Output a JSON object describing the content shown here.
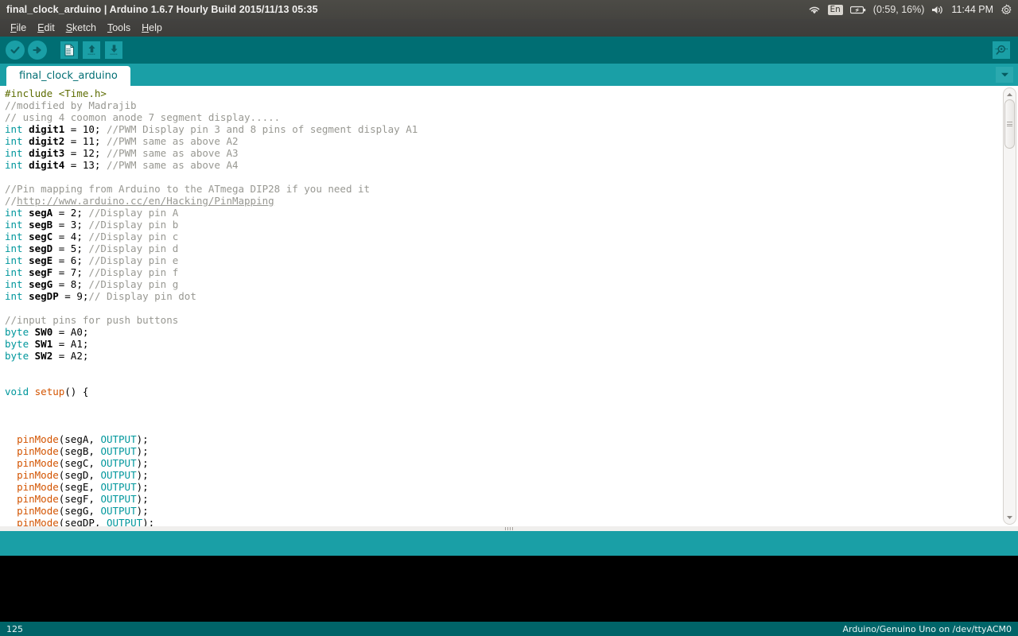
{
  "window": {
    "title": "final_clock_arduino | Arduino 1.6.7 Hourly Build 2015/11/13 05:35"
  },
  "tray": {
    "wifi_icon": "wifi-icon",
    "keyboard_layout": "En",
    "battery_icon": "battery-charging-icon",
    "battery_status": "(0:59, 16%)",
    "volume_icon": "volume-icon",
    "clock": "11:44 PM",
    "settings_icon": "gear-icon"
  },
  "menubar": {
    "items": [
      {
        "mnemonic": "F",
        "rest": "ile"
      },
      {
        "mnemonic": "E",
        "rest": "dit"
      },
      {
        "mnemonic": "S",
        "rest": "ketch"
      },
      {
        "mnemonic": "T",
        "rest": "ools"
      },
      {
        "mnemonic": "H",
        "rest": "elp"
      }
    ]
  },
  "toolbar": {
    "verify": "Verify",
    "upload": "Upload",
    "new": "New",
    "open": "Open",
    "save": "Save",
    "serial_monitor": "Serial Monitor"
  },
  "tabs": {
    "active_label": "final_clock_arduino",
    "menu_icon": "chevron-down-icon"
  },
  "editor": {
    "lines": [
      [
        {
          "t": "#include ",
          "c": "pp"
        },
        {
          "t": "<Time.h>",
          "c": "pp"
        }
      ],
      [
        {
          "t": "//modified by Madrajib",
          "c": "c"
        }
      ],
      [
        {
          "t": "// using 4 coomon anode 7 segment display.....",
          "c": "c"
        }
      ],
      [
        {
          "t": "int",
          "c": "k"
        },
        {
          "t": " ",
          "c": ""
        },
        {
          "t": "digit1",
          "c": "b"
        },
        {
          "t": " = 10; ",
          "c": ""
        },
        {
          "t": "//PWM Display pin 3 and 8 pins of segment display A1",
          "c": "c"
        }
      ],
      [
        {
          "t": "int",
          "c": "k"
        },
        {
          "t": " ",
          "c": ""
        },
        {
          "t": "digit2",
          "c": "b"
        },
        {
          "t": " = 11; ",
          "c": ""
        },
        {
          "t": "//PWM same as above A2",
          "c": "c"
        }
      ],
      [
        {
          "t": "int",
          "c": "k"
        },
        {
          "t": " ",
          "c": ""
        },
        {
          "t": "digit3",
          "c": "b"
        },
        {
          "t": " = 12; ",
          "c": ""
        },
        {
          "t": "//PWM same as above A3",
          "c": "c"
        }
      ],
      [
        {
          "t": "int",
          "c": "k"
        },
        {
          "t": " ",
          "c": ""
        },
        {
          "t": "digit4",
          "c": "b"
        },
        {
          "t": " = 13; ",
          "c": ""
        },
        {
          "t": "//PWM same as above A4",
          "c": "c"
        }
      ],
      [
        {
          "t": "",
          "c": ""
        }
      ],
      [
        {
          "t": "//Pin mapping from Arduino to the ATmega DIP28 if you need it",
          "c": "c"
        }
      ],
      [
        {
          "t": "//",
          "c": "c"
        },
        {
          "t": "http://www.arduino.cc/en/Hacking/PinMapping",
          "c": "lnk"
        }
      ],
      [
        {
          "t": "int",
          "c": "k"
        },
        {
          "t": " ",
          "c": ""
        },
        {
          "t": "segA",
          "c": "b"
        },
        {
          "t": " = 2; ",
          "c": ""
        },
        {
          "t": "//Display pin A",
          "c": "c"
        }
      ],
      [
        {
          "t": "int",
          "c": "k"
        },
        {
          "t": " ",
          "c": ""
        },
        {
          "t": "segB",
          "c": "b"
        },
        {
          "t": " = 3; ",
          "c": ""
        },
        {
          "t": "//Display pin b",
          "c": "c"
        }
      ],
      [
        {
          "t": "int",
          "c": "k"
        },
        {
          "t": " ",
          "c": ""
        },
        {
          "t": "segC",
          "c": "b"
        },
        {
          "t": " = 4; ",
          "c": ""
        },
        {
          "t": "//Display pin c",
          "c": "c"
        }
      ],
      [
        {
          "t": "int",
          "c": "k"
        },
        {
          "t": " ",
          "c": ""
        },
        {
          "t": "segD",
          "c": "b"
        },
        {
          "t": " = 5; ",
          "c": ""
        },
        {
          "t": "//Display pin d",
          "c": "c"
        }
      ],
      [
        {
          "t": "int",
          "c": "k"
        },
        {
          "t": " ",
          "c": ""
        },
        {
          "t": "segE",
          "c": "b"
        },
        {
          "t": " = 6; ",
          "c": ""
        },
        {
          "t": "//Display pin e",
          "c": "c"
        }
      ],
      [
        {
          "t": "int",
          "c": "k"
        },
        {
          "t": " ",
          "c": ""
        },
        {
          "t": "segF",
          "c": "b"
        },
        {
          "t": " = 7; ",
          "c": ""
        },
        {
          "t": "//Display pin f",
          "c": "c"
        }
      ],
      [
        {
          "t": "int",
          "c": "k"
        },
        {
          "t": " ",
          "c": ""
        },
        {
          "t": "segG",
          "c": "b"
        },
        {
          "t": " = 8; ",
          "c": ""
        },
        {
          "t": "//Display pin g",
          "c": "c"
        }
      ],
      [
        {
          "t": "int",
          "c": "k"
        },
        {
          "t": " ",
          "c": ""
        },
        {
          "t": "segDP",
          "c": "b"
        },
        {
          "t": " = 9;",
          "c": ""
        },
        {
          "t": "// Display pin dot",
          "c": "c"
        }
      ],
      [
        {
          "t": "",
          "c": ""
        }
      ],
      [
        {
          "t": "//input pins for push buttons",
          "c": "c"
        }
      ],
      [
        {
          "t": "byte",
          "c": "k"
        },
        {
          "t": " ",
          "c": ""
        },
        {
          "t": "SW0",
          "c": "b"
        },
        {
          "t": " = A0;",
          "c": ""
        }
      ],
      [
        {
          "t": "byte",
          "c": "k"
        },
        {
          "t": " ",
          "c": ""
        },
        {
          "t": "SW1",
          "c": "b"
        },
        {
          "t": " = A1;",
          "c": ""
        }
      ],
      [
        {
          "t": "byte",
          "c": "k"
        },
        {
          "t": " ",
          "c": ""
        },
        {
          "t": "SW2",
          "c": "b"
        },
        {
          "t": " = A2;",
          "c": ""
        }
      ],
      [
        {
          "t": "",
          "c": ""
        }
      ],
      [
        {
          "t": "",
          "c": ""
        }
      ],
      [
        {
          "t": "void",
          "c": "k"
        },
        {
          "t": " ",
          "c": ""
        },
        {
          "t": "setup",
          "c": "fn"
        },
        {
          "t": "() {",
          "c": ""
        }
      ],
      [
        {
          "t": "",
          "c": ""
        }
      ],
      [
        {
          "t": "",
          "c": ""
        }
      ],
      [
        {
          "t": "",
          "c": ""
        }
      ],
      [
        {
          "t": "  ",
          "c": ""
        },
        {
          "t": "pinMode",
          "c": "fn"
        },
        {
          "t": "(segA, ",
          "c": ""
        },
        {
          "t": "OUTPUT",
          "c": "cst"
        },
        {
          "t": ");",
          "c": ""
        }
      ],
      [
        {
          "t": "  ",
          "c": ""
        },
        {
          "t": "pinMode",
          "c": "fn"
        },
        {
          "t": "(segB, ",
          "c": ""
        },
        {
          "t": "OUTPUT",
          "c": "cst"
        },
        {
          "t": ");",
          "c": ""
        }
      ],
      [
        {
          "t": "  ",
          "c": ""
        },
        {
          "t": "pinMode",
          "c": "fn"
        },
        {
          "t": "(segC, ",
          "c": ""
        },
        {
          "t": "OUTPUT",
          "c": "cst"
        },
        {
          "t": ");",
          "c": ""
        }
      ],
      [
        {
          "t": "  ",
          "c": ""
        },
        {
          "t": "pinMode",
          "c": "fn"
        },
        {
          "t": "(segD, ",
          "c": ""
        },
        {
          "t": "OUTPUT",
          "c": "cst"
        },
        {
          "t": ");",
          "c": ""
        }
      ],
      [
        {
          "t": "  ",
          "c": ""
        },
        {
          "t": "pinMode",
          "c": "fn"
        },
        {
          "t": "(segE, ",
          "c": ""
        },
        {
          "t": "OUTPUT",
          "c": "cst"
        },
        {
          "t": ");",
          "c": ""
        }
      ],
      [
        {
          "t": "  ",
          "c": ""
        },
        {
          "t": "pinMode",
          "c": "fn"
        },
        {
          "t": "(segF, ",
          "c": ""
        },
        {
          "t": "OUTPUT",
          "c": "cst"
        },
        {
          "t": ");",
          "c": ""
        }
      ],
      [
        {
          "t": "  ",
          "c": ""
        },
        {
          "t": "pinMode",
          "c": "fn"
        },
        {
          "t": "(segG, ",
          "c": ""
        },
        {
          "t": "OUTPUT",
          "c": "cst"
        },
        {
          "t": ");",
          "c": ""
        }
      ],
      [
        {
          "t": "  ",
          "c": ""
        },
        {
          "t": "pinMode",
          "c": "fn"
        },
        {
          "t": "(segDP, ",
          "c": ""
        },
        {
          "t": "OUTPUT",
          "c": "cst"
        },
        {
          "t": ");",
          "c": ""
        }
      ]
    ]
  },
  "message_bar": {
    "text": ""
  },
  "console": {
    "text": ""
  },
  "statusbar": {
    "line_number": "125",
    "board_info": "Arduino/Genuino Uno on /dev/ttyACM0"
  },
  "colors": {
    "titlebar": "#474641",
    "toolbar_teal": "#006e73",
    "accent_teal": "#1a9fa6",
    "status_teal": "#006468",
    "keyword": "#00979c",
    "comment": "#989892",
    "function": "#d35400",
    "preprocessor": "#5e6d03"
  }
}
